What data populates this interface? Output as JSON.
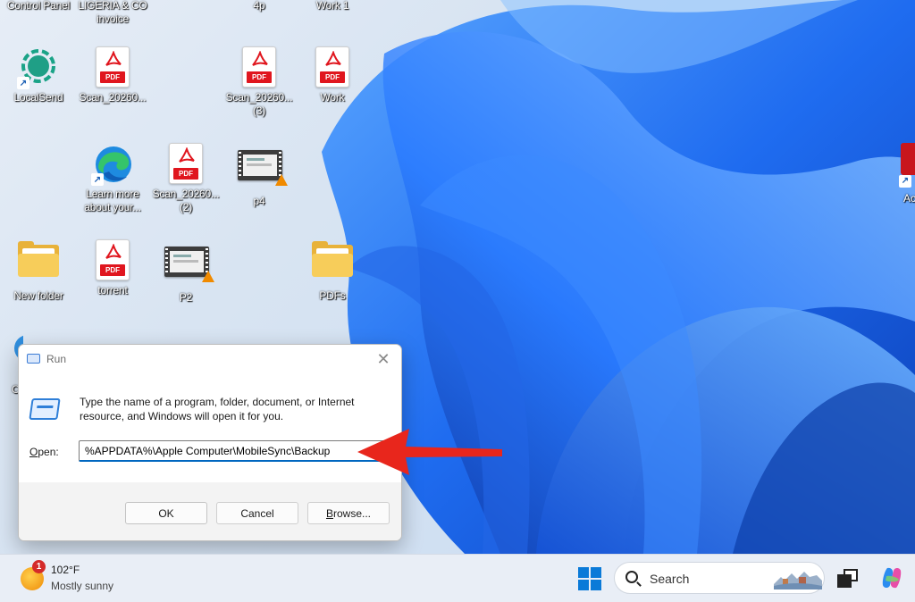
{
  "desktop": {
    "icons": [
      {
        "id": "control-panel",
        "label": "Control Panel"
      },
      {
        "id": "ligeria-invoice",
        "label": "LIGERIA & CO invoice"
      },
      {
        "id": "4p",
        "label": "4p"
      },
      {
        "id": "work1",
        "label": "Work 1"
      },
      {
        "id": "localsend",
        "label": "LocalSend"
      },
      {
        "id": "scan1",
        "label": "Scan_20260..."
      },
      {
        "id": "scan3",
        "label": "Scan_20260... (3)"
      },
      {
        "id": "work",
        "label": "Work"
      },
      {
        "id": "edge",
        "label": "Learn more about your..."
      },
      {
        "id": "scan2",
        "label": "Scan_20260... (2)"
      },
      {
        "id": "p4",
        "label": "p4"
      },
      {
        "id": "new-folder",
        "label": "New folder"
      },
      {
        "id": "torrent",
        "label": "torrent"
      },
      {
        "id": "p2",
        "label": "P2"
      },
      {
        "id": "pdfs",
        "label": "PDFs"
      },
      {
        "id": "partial-right",
        "label": "Ac Ac"
      },
      {
        "id": "partial-left",
        "label": "C"
      }
    ],
    "pdf_tag": "PDF"
  },
  "run_dialog": {
    "title": "Run",
    "description": "Type the name of a program, folder, document, or Internet resource, and Windows will open it for you.",
    "open_label_accel": "O",
    "open_label_rest": "pen:",
    "open_value": "%APPDATA%\\Apple Computer\\MobileSync\\Backup",
    "ok_label": "OK",
    "cancel_label": "Cancel",
    "browse_accel": "B",
    "browse_rest": "rowse...",
    "close_glyph": "✕"
  },
  "taskbar": {
    "weather_badge": "1",
    "weather_temp": "102°F",
    "weather_condition": "Mostly sunny",
    "search_label": "Search"
  },
  "colors": {
    "arrow": "#e8261c",
    "accent": "#0067c0",
    "wallpaper_blue": "#1c6dff"
  }
}
